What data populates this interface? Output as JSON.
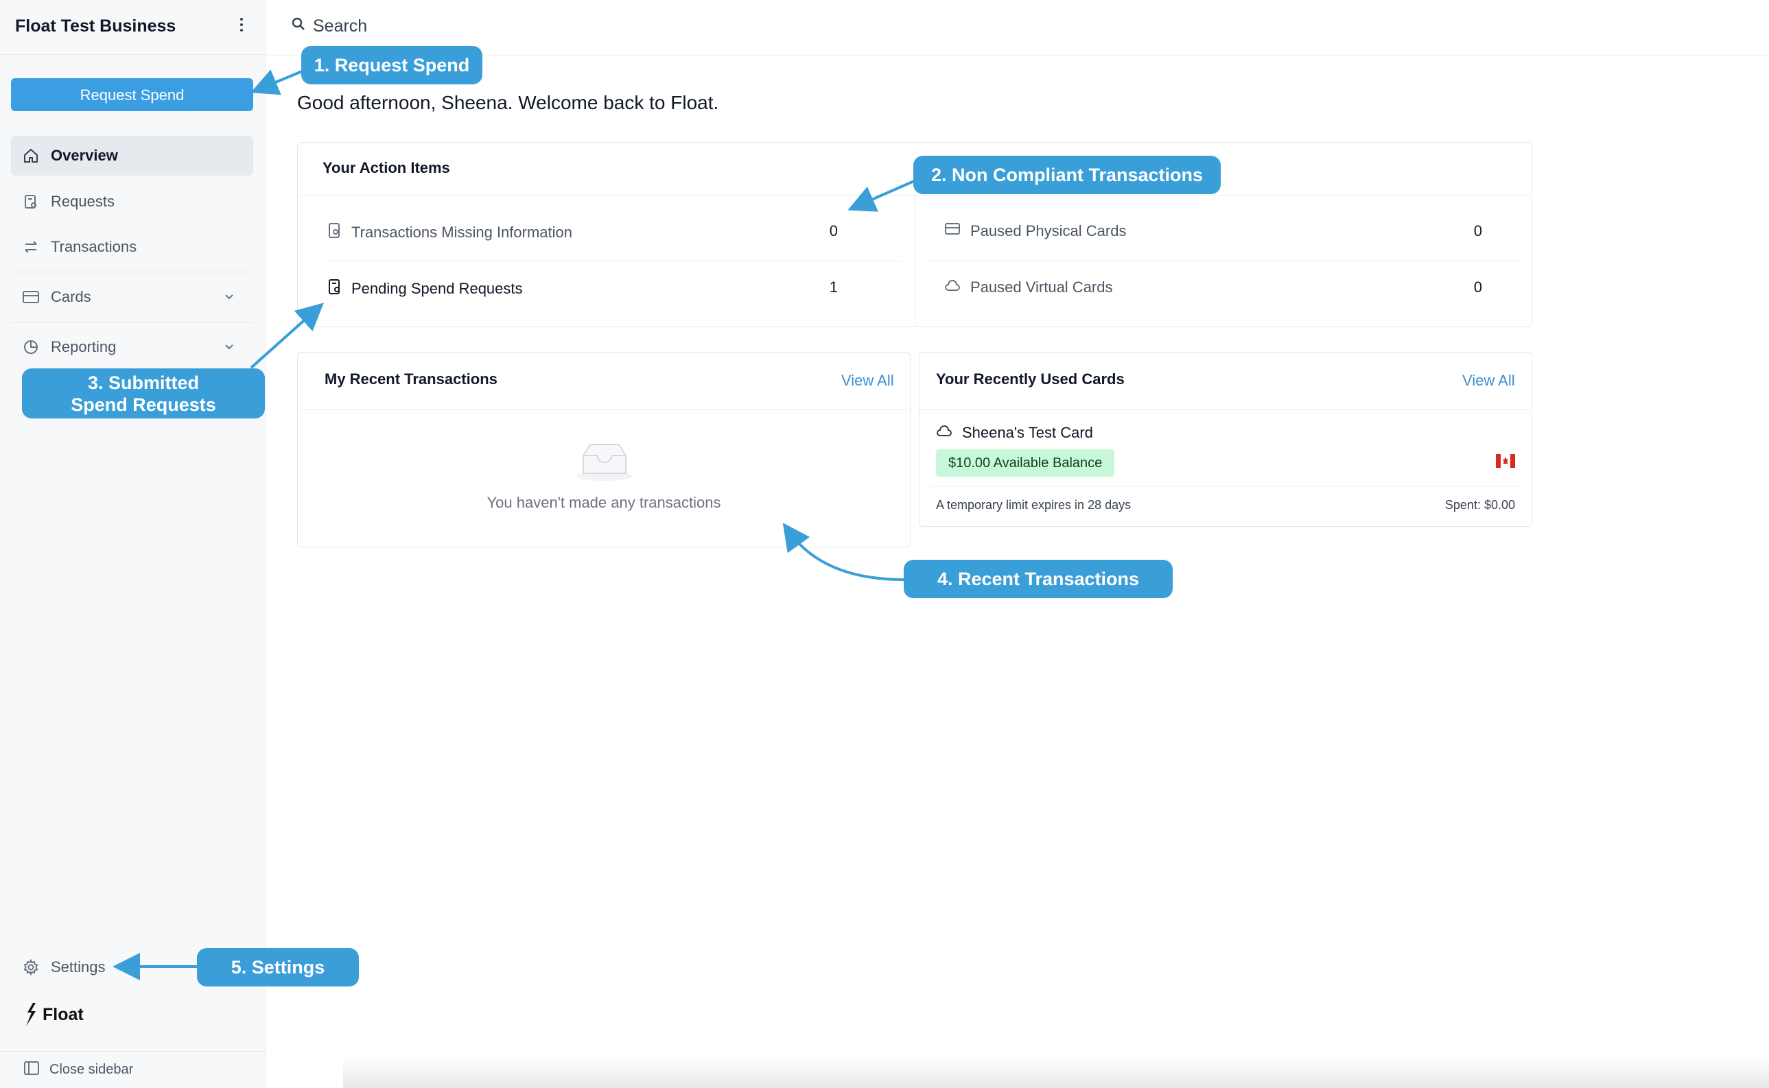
{
  "sidebar": {
    "business_name": "Float Test Business",
    "request_button": "Request Spend",
    "nav": {
      "overview": "Overview",
      "requests": "Requests",
      "transactions": "Transactions",
      "cards": "Cards",
      "reporting": "Reporting"
    },
    "settings": "Settings",
    "logo_text": "Float",
    "close_sidebar": "Close sidebar"
  },
  "topbar": {
    "search_label": "Search"
  },
  "greeting": "Good afternoon, Sheena. Welcome back to Float.",
  "action_items": {
    "title": "Your Action Items",
    "left_rows": [
      {
        "label": "Transactions Missing Information",
        "count": "0"
      },
      {
        "label": "Pending Spend Requests",
        "count": "1"
      }
    ],
    "right_rows": [
      {
        "label": "Paused Physical Cards",
        "count": "0"
      },
      {
        "label": "Paused Virtual Cards",
        "count": "0"
      }
    ]
  },
  "recent_transactions": {
    "title": "My Recent Transactions",
    "view_all": "View All",
    "empty_message": "You haven't made any transactions"
  },
  "recent_cards": {
    "title": "Your Recently Used Cards",
    "view_all": "View All",
    "card": {
      "name": "Sheena's Test Card",
      "balance": "$10.00 Available Balance",
      "limit_note": "A temporary limit expires in 28 days",
      "spent": "Spent: $0.00"
    }
  },
  "annotations": {
    "a1": "1. Request Spend",
    "a2": "2.  Non Compliant Transactions",
    "a3_line1": "3. Submitted",
    "a3_line2": "Spend Requests",
    "a4": "4. Recent Transactions",
    "a5": "5. Settings"
  },
  "colors": {
    "accent": "#3b9ee2",
    "callout": "#3a9ed8",
    "balance_badge": "#c9f7d9"
  }
}
